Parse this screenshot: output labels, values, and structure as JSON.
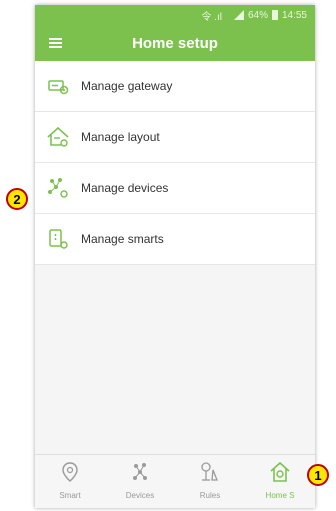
{
  "status_bar": {
    "signal": "令 .ıl",
    "battery": "64%",
    "time": "14:55"
  },
  "appbar": {
    "title": "Home setup"
  },
  "list": {
    "items": [
      {
        "label": "Manage gateway",
        "icon": "gateway-settings-icon"
      },
      {
        "label": "Manage layout",
        "icon": "house-layout-icon"
      },
      {
        "label": "Manage devices",
        "icon": "device-network-icon"
      },
      {
        "label": "Manage smarts",
        "icon": "smart-settings-icon"
      }
    ]
  },
  "bottom_nav": {
    "items": [
      {
        "label": "Smart",
        "icon": "location-pin-icon",
        "active": false
      },
      {
        "label": "Devices",
        "icon": "device-network-icon",
        "active": false
      },
      {
        "label": "Rules",
        "icon": "rules-icon",
        "active": false
      },
      {
        "label": "Home S",
        "icon": "home-gear-icon",
        "active": true
      }
    ]
  },
  "callouts": {
    "first": "1",
    "second": "2"
  },
  "colors": {
    "brand": "#7cc14d",
    "callout_fill": "#ffe600",
    "callout_border": "#c00000"
  }
}
